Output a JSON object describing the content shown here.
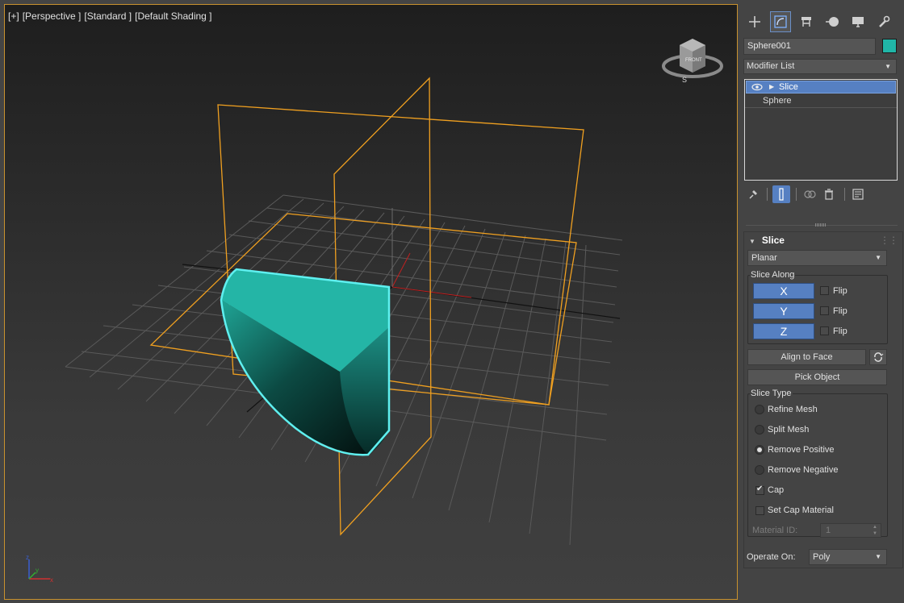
{
  "viewport": {
    "labels": [
      "[+]",
      "[Perspective ]",
      "[Standard ]",
      "[Default Shading ]"
    ],
    "viewcube": {
      "face": "FRONT",
      "compass": "S"
    },
    "axes": {
      "x": "x",
      "y": "y",
      "z": "z"
    }
  },
  "panel": {
    "tabs": [
      "create-icon",
      "modify-icon",
      "hierarchy-icon",
      "motion-icon",
      "display-icon",
      "utilities-icon"
    ],
    "object_name": "Sphere001",
    "object_color": "#20b6a8",
    "modifier_list": "Modifier List",
    "stack": [
      {
        "label": "Slice",
        "selected": true
      },
      {
        "label": "Sphere",
        "selected": false
      }
    ],
    "rollout": {
      "title": "Slice",
      "slice_mode": "Planar",
      "slice_along_label": "Slice Along",
      "axes": [
        {
          "label": "X",
          "flip": "Flip"
        },
        {
          "label": "Y",
          "flip": "Flip"
        },
        {
          "label": "Z",
          "flip": "Flip"
        }
      ],
      "align_to_face": "Align to Face",
      "pick_object": "Pick Object",
      "slice_type_label": "Slice Type",
      "slice_types": [
        "Refine Mesh",
        "Split Mesh",
        "Remove Positive",
        "Remove Negative"
      ],
      "slice_type_selected": "Remove Positive",
      "cap": "Cap",
      "cap_checked": true,
      "set_cap_material": "Set Cap Material",
      "set_cap_material_checked": false,
      "material_id_label": "Material  ID:",
      "material_id_value": "1",
      "operate_on_label": "Operate On:",
      "operate_on_value": "Poly"
    }
  },
  "colors": {
    "accent": "#5680c2",
    "gizmo": "#f0a020",
    "object": "#20b6a8",
    "selection_outline": "#5ff0f0"
  }
}
